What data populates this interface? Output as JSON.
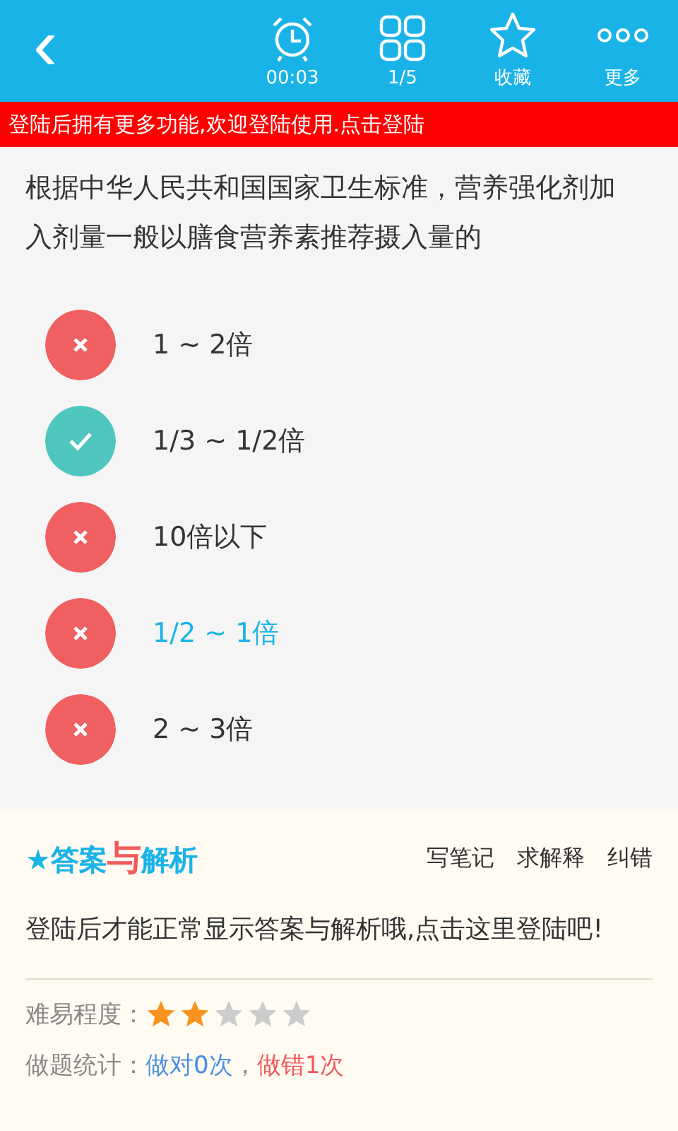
{
  "toolbar": {
    "back": "‹",
    "actions": [
      {
        "kind": "alarm",
        "label": "00:03"
      },
      {
        "kind": "grid",
        "label": "1/5"
      },
      {
        "kind": "star",
        "label": "收藏"
      },
      {
        "kind": "dots",
        "label": "更多"
      }
    ]
  },
  "banner": "登陆后拥有更多功能,欢迎登陆使用.点击登陆",
  "question": "根据中华人民共和国国家卫生标准，营养强化剂加入剂量一般以膳食营养素推荐摄入量的",
  "options": [
    {
      "text": "1 ~ 2倍",
      "kind": "wrong",
      "selected": false
    },
    {
      "text": "1/3 ~ 1/2倍",
      "kind": "correct",
      "selected": false
    },
    {
      "text": "10倍以下",
      "kind": "wrong",
      "selected": false
    },
    {
      "text": "1/2 ~ 1倍",
      "kind": "wrong",
      "selected": true
    },
    {
      "text": "2 ~ 3倍",
      "kind": "wrong",
      "selected": false
    }
  ],
  "analysis": {
    "title": {
      "star": "★",
      "before": "答案",
      "mid": "与",
      "after": "解析"
    },
    "links": [
      "写笔记",
      "求解释",
      "纠错"
    ],
    "message": "登陆后才能正常显示答案与解析哦,点击这里登陆吧!",
    "difficulty": {
      "label": "难易程度：",
      "stars": 2
    },
    "stats": {
      "label": "做题统计：",
      "right": "做对0次",
      "sep": "，",
      "wrong": "做错1次"
    }
  }
}
